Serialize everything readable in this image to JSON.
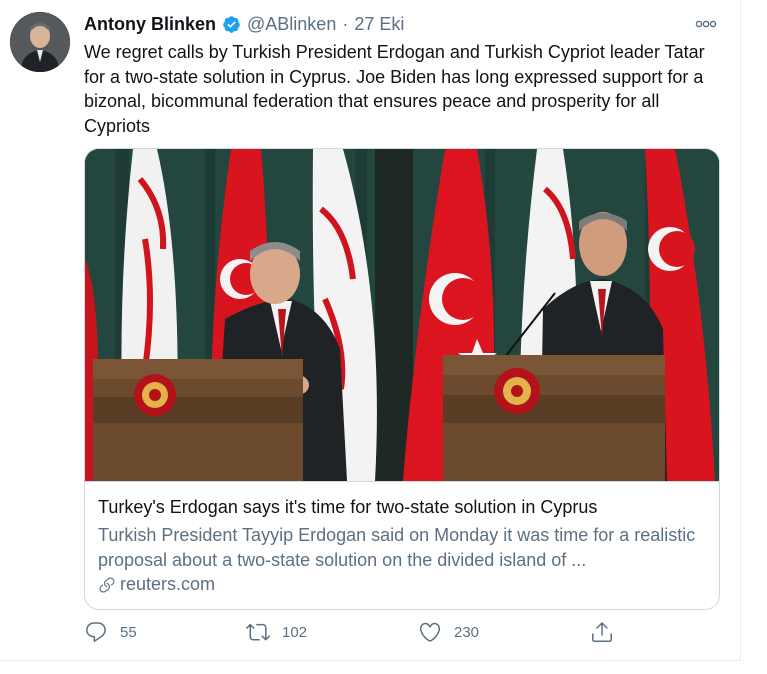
{
  "tweet": {
    "author_name": "Antony Blinken",
    "handle": "@ABlinken",
    "separator": "·",
    "date": "27 Eki",
    "more_label": "⋯",
    "text": "We regret calls by Turkish President Erdogan and Turkish Cypriot leader Tatar for a two-state solution in Cyprus. Joe Biden has long expressed support for a bizonal, bicommunal federation that ensures peace and prosperity for all Cypriots"
  },
  "card": {
    "title": "Turkey's Erdogan says it's time for two-state solution in Cyprus",
    "description": "Turkish President Tayyip Erdogan said on Monday it was time for a realistic proposal about a two-state solution on the divided island of ...",
    "domain": "reuters.com"
  },
  "actions": {
    "reply_count": "55",
    "retweet_count": "102",
    "like_count": "230"
  },
  "colors": {
    "text_primary": "#0f1419",
    "text_secondary": "#5b7083",
    "verified_blue": "#1da1f2",
    "border": "#cfd9de",
    "flag_red": "#e30a17"
  },
  "icons": {
    "verified": "verified-badge-icon",
    "more": "more-options-icon",
    "link": "link-icon",
    "reply": "reply-icon",
    "retweet": "retweet-icon",
    "like": "heart-icon",
    "share": "share-icon"
  }
}
